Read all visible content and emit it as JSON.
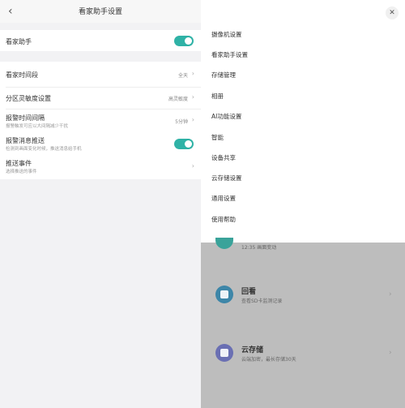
{
  "left_panel": {
    "title": "看家助手设置",
    "back_icon": "chevron-left-icon",
    "rows": [
      {
        "label": "看家助手"
      },
      {
        "label": "看家时间段",
        "value": "全天"
      },
      {
        "label": "分区灵敏度设置",
        "value": "高灵敏度"
      },
      {
        "label": "报警时间间隔",
        "sub": "报警触发可应以大间隔减少干扰",
        "value": "5分钟"
      },
      {
        "label": "报警消息推送",
        "sub": "检测到画面变化时候，推送消息给手机"
      },
      {
        "label": "推送事件",
        "sub": "选择推送的事件"
      }
    ]
  },
  "menu": {
    "items": [
      "摄像机设置",
      "看家助手设置",
      "存储管理",
      "相册",
      "AI功能设置",
      "智能",
      "设备共享",
      "云存储设置",
      "通用设置",
      "使用帮助"
    ],
    "close_icon": "close-icon"
  },
  "background_features": [
    {
      "title": "回看",
      "sub": "查看SD卡监测记录",
      "color": "#3d86a8"
    },
    {
      "title": "云存储",
      "sub": "云端加密，最长存储30天",
      "color": "#6a6fb3"
    }
  ],
  "partial_text": "12:35 画面变动"
}
